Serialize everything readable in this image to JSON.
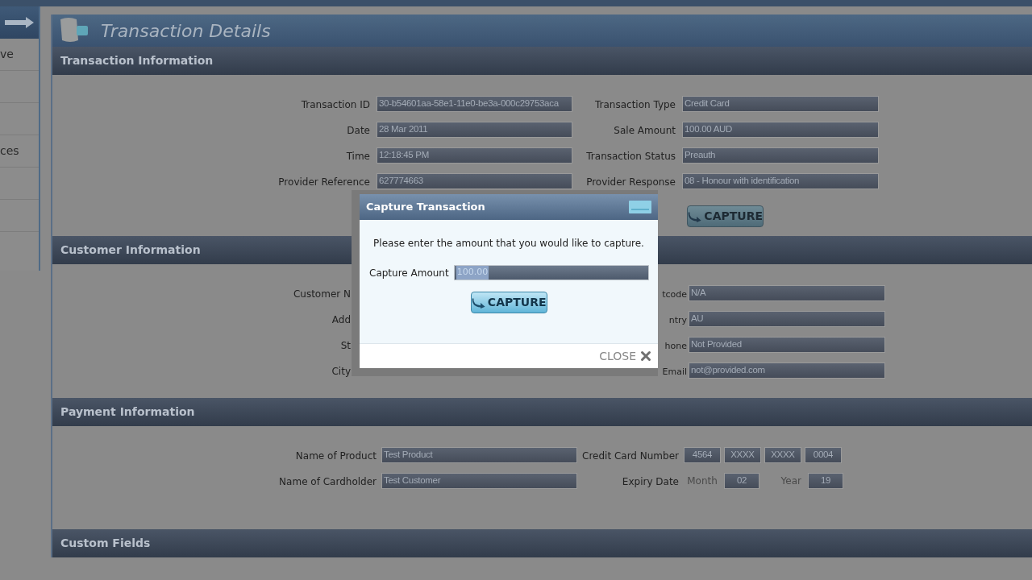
{
  "sidebar": {
    "items": [
      {
        "label": "ve"
      },
      {
        "label": "ces"
      }
    ]
  },
  "page_title": "Transaction Details",
  "transaction_information": {
    "title": "Transaction Information",
    "left_rows": [
      {
        "label": "Transaction ID",
        "value": "30-b54601aa-58e1-11e0-be3a-000c29753aca"
      },
      {
        "label": "Date",
        "value": "28 Mar 2011"
      },
      {
        "label": "Time",
        "value": "12:18:45 PM"
      },
      {
        "label": "Provider Reference",
        "value": "627774663"
      }
    ],
    "right_rows": [
      {
        "label": "Transaction Type",
        "value": "Credit Card"
      },
      {
        "label": "Sale Amount",
        "value": "100.00 AUD"
      },
      {
        "label": "Transaction Status",
        "value": "Preauth"
      },
      {
        "label": "Provider Response",
        "value": "08 - Honour with identification"
      }
    ],
    "button": "CAPTURE"
  },
  "customer_information": {
    "title": "Customer Information",
    "left_labels": [
      "Customer N",
      "Add",
      "St",
      "City"
    ],
    "right_rows": [
      {
        "label": "tcode",
        "value": "N/A"
      },
      {
        "label": "ntry",
        "value": "AU"
      },
      {
        "label": "hone",
        "value": "Not Provided"
      },
      {
        "label": "Email",
        "value": "not@provided.com"
      }
    ]
  },
  "payment_information": {
    "title": "Payment Information",
    "left_rows": [
      {
        "label": "Name of Product",
        "value": "Test Product"
      },
      {
        "label": "Name of Cardholder",
        "value": "Test Customer"
      }
    ],
    "card_number": {
      "label": "Credit Card Number",
      "parts": [
        "4564",
        "XXXX",
        "XXXX",
        "0004"
      ]
    },
    "expiry": {
      "label": "Expiry Date",
      "month_label": "Month",
      "month": "02",
      "year_label": "Year",
      "year": "19"
    }
  },
  "custom_fields": {
    "title": "Custom Fields"
  },
  "dialog": {
    "title": "Capture Transaction",
    "message": "Please enter the amount that you would like to capture.",
    "field_label": "Capture Amount",
    "value": "100.00",
    "button": "CAPTURE",
    "close": "CLOSE"
  }
}
